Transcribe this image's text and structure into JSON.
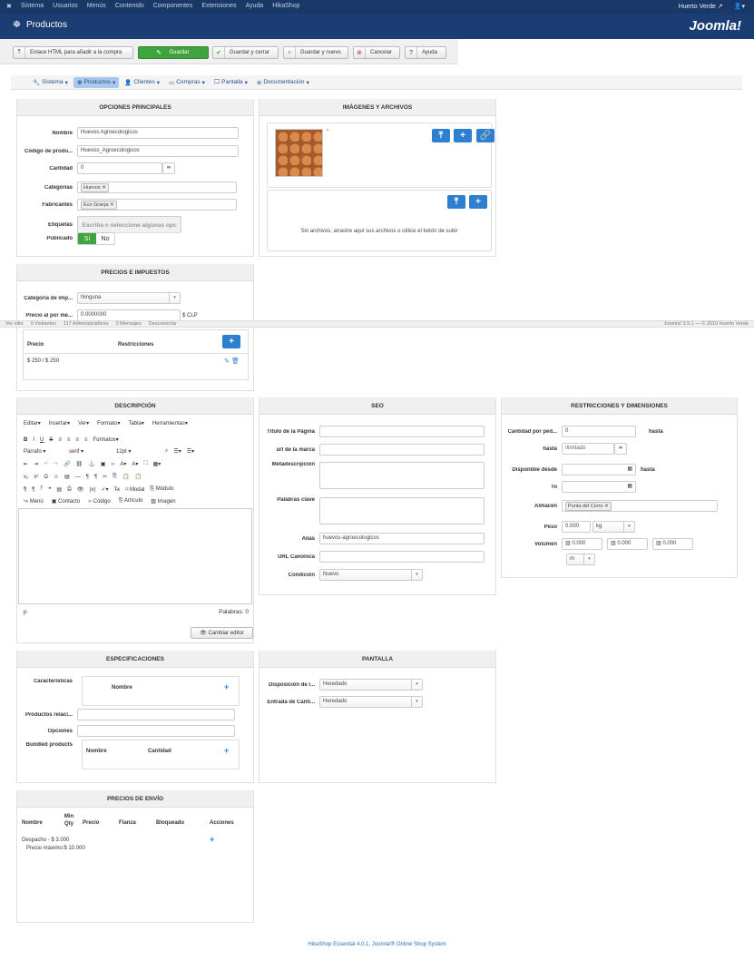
{
  "topnav": {
    "menu": [
      "Sistema",
      "Usuarios",
      "Menús",
      "Contenido",
      "Componentes",
      "Extensiones",
      "Ayuda",
      "HikaShop"
    ],
    "user": "Huerto Verde",
    "external_icon": "external-link-icon",
    "user_icon": "user-icon"
  },
  "header": {
    "title": "Productos",
    "logo": "Joomla!"
  },
  "toolbar": {
    "enlace": "Enlace HTML para añadir a la compra",
    "guardar": "Guardar",
    "guardar_cerrar": "Guardar y cerrar",
    "guardar_nuevo": "Guardar y nuevo",
    "cancelar": "Cancelar",
    "ayuda": "Ayuda"
  },
  "submenu": [
    "Sistema",
    "Productos",
    "Clientes",
    "Compras",
    "Pantalla",
    "Documentación"
  ],
  "opciones": {
    "title": "OPCIONES PRINCIPALES",
    "nombre_label": "Nombre",
    "nombre": "Huevos Agroecologicos",
    "codigo_label": "Código de produ...",
    "codigo": "Huevos_Agroecologicos",
    "cantidad_label": "Cantidad",
    "cantidad": "0",
    "categorias_label": "Categorías",
    "categoria_tag": "Huevos",
    "fabricantes_label": "Fabricantes",
    "fabricante_tag": "Eco Granja",
    "etiquetas_label": "Etiquetas",
    "etiquetas_placeholder": "Escriba o seleccione algunas opc",
    "publicado_label": "Publicado",
    "si": "Sí",
    "no": "No"
  },
  "imagenes": {
    "title": "IMÁGENES Y ARCHIVOS",
    "sin_archivos": "Sin archivos, arrastre aquí sus archivos o utilice el botón de subir"
  },
  "precios": {
    "title": "PRECIOS E IMPUESTOS",
    "categoria_label": "Categoría de imp...",
    "categoria": "Ninguna",
    "precio_label": "Precio al por me...",
    "precio": "0.0000000",
    "moneda": "$ CLP",
    "col_precio": "Precio",
    "col_restricciones": "Restricciones",
    "row_precio": "$ 250 / $ 250"
  },
  "statusbar": {
    "left": [
      "Ver sitio",
      "0 Visitantes",
      "117 Administradores",
      "0 Mensajes",
      "Desconectar"
    ],
    "right": "Joomla! 3.9.1 — © 2019 Huerto Verde"
  },
  "descripcion": {
    "title": "DESCRIPCIÓN",
    "menu": [
      "Editar",
      "Insertar",
      "Ver",
      "Formato",
      "Tabla",
      "Herramientas"
    ],
    "formatos": "Formatos",
    "parrafo": "Párrafo",
    "fuente": "serif",
    "tamano": "12pt",
    "insert_items": [
      "Menú",
      "Contacto",
      "Código",
      "Artículo",
      "Imagen"
    ],
    "modal": "Modal",
    "modulo": "Módulo",
    "path": "p",
    "palabras": "Palabras: 0",
    "cambiar_editor": "Cambiar editor"
  },
  "seo": {
    "title": "SEO",
    "titulo_label": "Título de la Página",
    "marca_label": "url de la marca",
    "meta_label": "Metadescripción",
    "palabras_label": "Palabras clave",
    "alias_label": "Alias",
    "alias": "huevos-agroecologicos",
    "canonica_label": "URL Canónica",
    "condicion_label": "Condición",
    "condicion": "Nuevo"
  },
  "restricciones": {
    "title": "RESTRICCIONES Y DIMENSIONES",
    "cantidad_label": "Cantidad por ped...",
    "cantidad": "0",
    "hasta": "hasta",
    "hasta_label": "hasta",
    "ilimitado": "Ilimitado",
    "disponible_label": "Disponible desde",
    "hasta2": "hasta",
    "to_label": "To",
    "almacen_label": "Almacén",
    "almacen_tag": "Punta del Cerro",
    "peso_label": "Peso",
    "peso": "0.000",
    "peso_unidad": "kg",
    "volumen_label": "Volumen",
    "vol1": "0.000",
    "vol2": "0.000",
    "vol3": "0.000",
    "vol_unidad": "m"
  },
  "especificaciones": {
    "title": "ESPECIFICACIONES",
    "caracteristicas_label": "Características",
    "col_nombre": "Nombre",
    "relacionados_label": "Productos relaci...",
    "opciones_label": "Opciones",
    "bundled_label": "Bundled products",
    "bundled_nombre": "Nombre",
    "bundled_cantidad": "Cantidad"
  },
  "pantalla": {
    "title": "PANTALLA",
    "disposicion_label": "Disposición de l...",
    "disposicion": "Heredado",
    "entrada_label": "Entrada de Canti...",
    "entrada": "Heredado"
  },
  "envio": {
    "title": "PRECIOS DE ENVÍO",
    "cols": [
      "Nombre",
      "Min Qty",
      "Precio",
      "Fianza",
      "Bloqueado",
      "Acciones"
    ],
    "row_nombre": "Despacho - $ 3.000",
    "row_max": "Precio máximo:$ 10.000"
  },
  "footer": "HikaShop Essential 4.0.1, Joomla!® Online Shop System"
}
